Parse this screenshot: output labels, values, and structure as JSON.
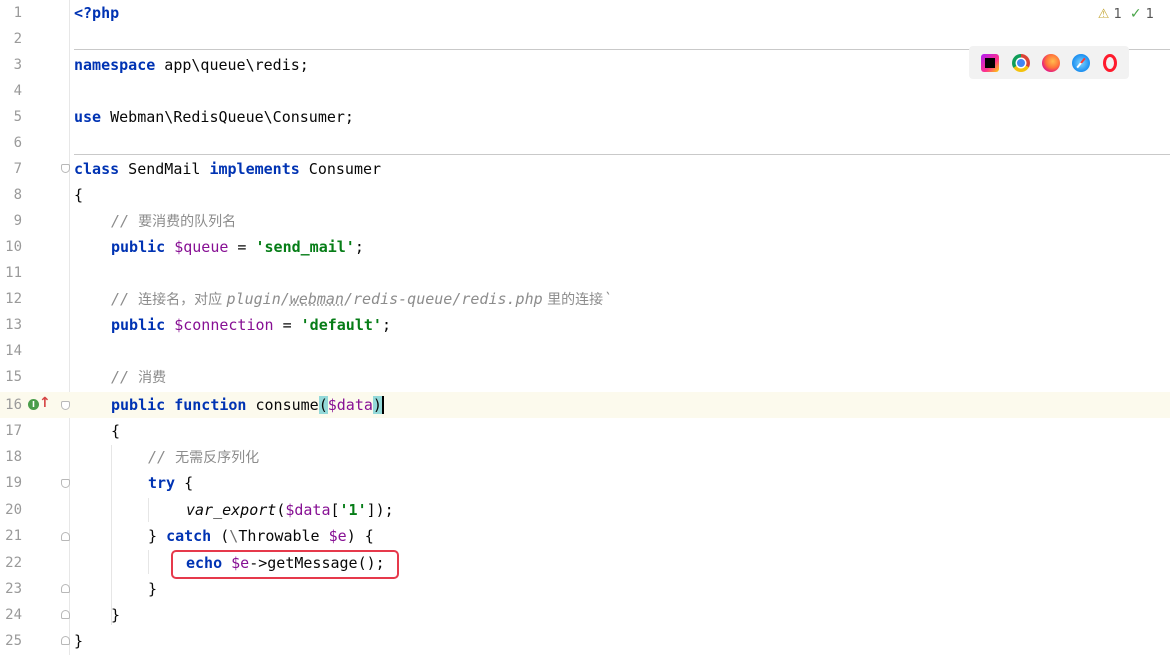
{
  "editor": {
    "inspections": {
      "warnings": "1",
      "ok": "1"
    },
    "browsers": [
      "phpstorm-icon",
      "chrome-icon",
      "firefox-icon",
      "safari-icon",
      "opera-icon"
    ],
    "lines": [
      {
        "n": "1"
      },
      {
        "n": "2"
      },
      {
        "n": "3"
      },
      {
        "n": "4"
      },
      {
        "n": "5"
      },
      {
        "n": "6"
      },
      {
        "n": "7"
      },
      {
        "n": "8"
      },
      {
        "n": "9"
      },
      {
        "n": "10"
      },
      {
        "n": "11"
      },
      {
        "n": "12"
      },
      {
        "n": "13"
      },
      {
        "n": "14"
      },
      {
        "n": "15"
      },
      {
        "n": "16"
      },
      {
        "n": "17"
      },
      {
        "n": "18"
      },
      {
        "n": "19"
      },
      {
        "n": "20"
      },
      {
        "n": "21"
      },
      {
        "n": "22"
      },
      {
        "n": "23"
      },
      {
        "n": "24"
      },
      {
        "n": "25"
      }
    ],
    "code": {
      "l1_tag": "<?php",
      "l3_kw": "namespace",
      "l3_rest": " app\\queue\\redis;",
      "l5_kw": "use",
      "l5_rest": " Webman\\RedisQueue\\Consumer;",
      "l7_kw1": "class",
      "l7_name": " SendMail ",
      "l7_kw2": "implements",
      "l7_iface": " Consumer",
      "l8": "{",
      "l9_cmt": "// ",
      "l9_cn": "要消费的队列名",
      "l10_kw": "public",
      "l10_var": " $queue",
      "l10_eq": " = ",
      "l10_str": "'send_mail'",
      "l10_end": ";",
      "l12_cmt": "// ",
      "l12_cn1": "连接名，对应 ",
      "l12_path1": "plugin/",
      "l12_path2": "webman",
      "l12_path3": "/redis-queue/redis.php",
      "l12_cn2": " 里的连接",
      "l12_tick": "`",
      "l13_kw": "public",
      "l13_var": " $connection",
      "l13_eq": " = ",
      "l13_str": "'default'",
      "l13_end": ";",
      "l15_cmt": "// ",
      "l15_cn": "消费",
      "l16_kw1": "public",
      "l16_kw2": " function",
      "l16_fn": " consume",
      "l16_open": "(",
      "l16_var": "$data",
      "l16_close": ")",
      "l17": "{",
      "l18_cmt": "// ",
      "l18_cn": "无需反序列化",
      "l19_kw": "try",
      "l19_rest": " {",
      "l20_fn": "var_export",
      "l20_open": "(",
      "l20_var": "$data",
      "l20_br1": "[",
      "l20_str": "'1'",
      "l20_br2": "]);",
      "l21_close": "} ",
      "l21_kw": "catch",
      "l21_mid": " (",
      "l21_bs": "\\",
      "l21_type": "Throwable ",
      "l21_var": "$e",
      "l21_end": ") {",
      "l22_kw": "echo",
      "l22_var": " $e",
      "l22_rest": "->getMessage();",
      "l23": "}",
      "l24": "}",
      "l25": "}"
    }
  }
}
